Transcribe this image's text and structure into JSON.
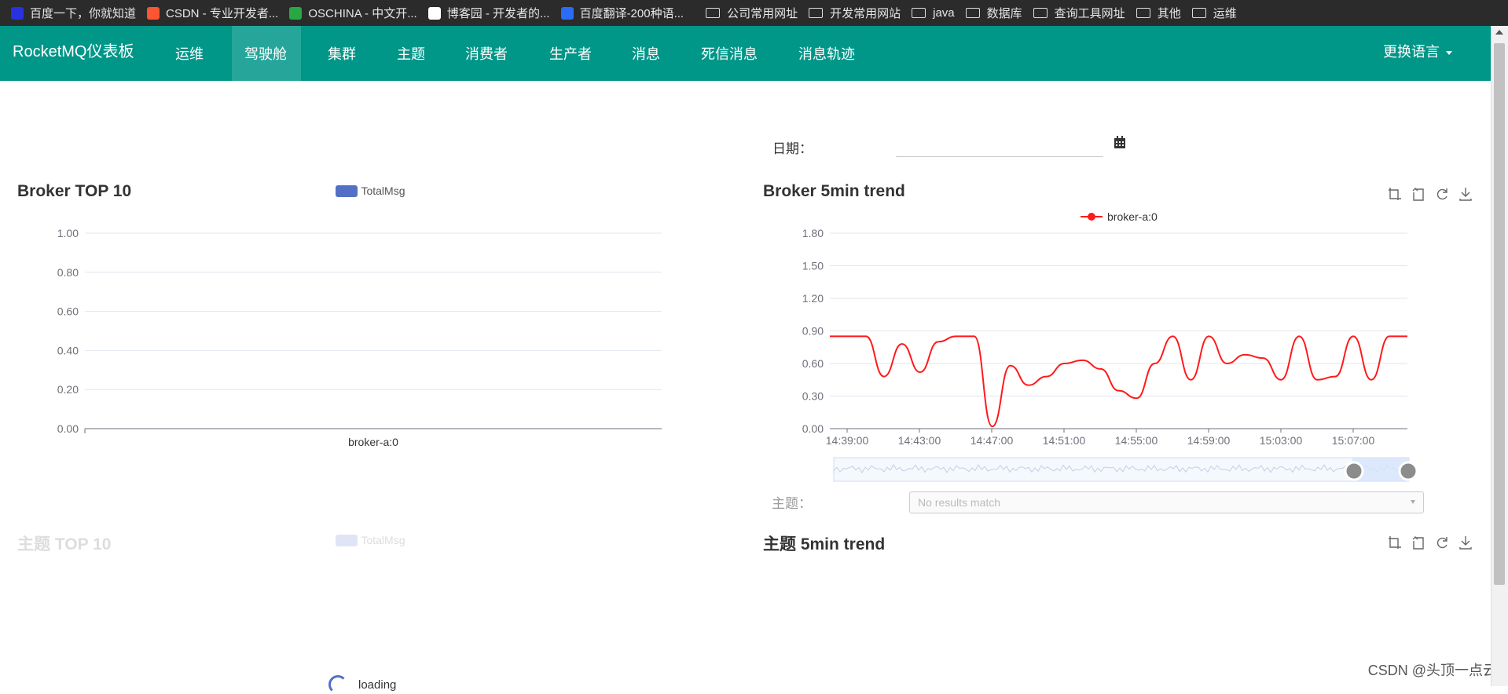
{
  "bookmarks": [
    {
      "label": "百度一下，你就知道",
      "icon": "baidu-icon",
      "color": "#2932e1"
    },
    {
      "label": "CSDN - 专业开发者...",
      "icon": "csdn-icon",
      "color": "#fc5531"
    },
    {
      "label": "OSCHINA - 中文开...",
      "icon": "oschina-icon",
      "color": "#28a745"
    },
    {
      "label": "博客园 - 开发者的...",
      "icon": "cnblogs-icon",
      "color": "#ffffff"
    },
    {
      "label": "百度翻译-200种语...",
      "icon": "translate-icon",
      "color": "#2b6cf6"
    },
    {
      "label": "公司常用网址",
      "icon": "folder-icon"
    },
    {
      "label": "开发常用网站",
      "icon": "folder-icon"
    },
    {
      "label": "java",
      "icon": "folder-icon"
    },
    {
      "label": "数据库",
      "icon": "folder-icon"
    },
    {
      "label": "查询工具网址",
      "icon": "folder-icon"
    },
    {
      "label": "其他",
      "icon": "folder-icon"
    },
    {
      "label": "运维",
      "icon": "folder-icon"
    }
  ],
  "nav": {
    "brand": "RocketMQ仪表板",
    "items": [
      "运维",
      "驾驶舱",
      "集群",
      "主题",
      "消费者",
      "生产者",
      "消息",
      "死信消息",
      "消息轨迹"
    ],
    "active": "驾驶舱",
    "language": "更换语言"
  },
  "date": {
    "label": "日期：",
    "value": ""
  },
  "topic_filter": {
    "label": "主题：",
    "placeholder": "No results match"
  },
  "panels": {
    "broker_top": "Broker TOP 10",
    "broker_trend": "Broker 5min trend",
    "topic_top": "主题 TOP 10",
    "topic_trend": "主题 5min trend"
  },
  "loading_text": "loading",
  "watermark": "CSDN @头顶一点云",
  "colors": {
    "nav": "#009688",
    "nav_active": "#26a69a",
    "bar": "#5470c6",
    "trend": "#ff1a1a"
  },
  "chart_data": [
    {
      "type": "bar",
      "legend": [
        "TotalMsg"
      ],
      "categories": [
        "broker-a:0"
      ],
      "values": [
        0
      ],
      "yticks": [
        "0.00",
        "0.20",
        "0.40",
        "0.60",
        "0.80",
        "1.00"
      ],
      "ylim": [
        0,
        1
      ],
      "grid": true
    },
    {
      "type": "line",
      "series": [
        {
          "name": "broker-a:0",
          "values": [
            0.85,
            0.85,
            0.85,
            0.48,
            0.78,
            0.52,
            0.8,
            0.85,
            0.85,
            0.02,
            0.58,
            0.4,
            0.48,
            0.6,
            0.63,
            0.55,
            0.35,
            0.28,
            0.6,
            0.85,
            0.45,
            0.85,
            0.6,
            0.68,
            0.65,
            0.45,
            0.85,
            0.45,
            0.48,
            0.85,
            0.45,
            0.85,
            0.85
          ]
        }
      ],
      "xticks": [
        "14:39:00",
        "14:43:00",
        "14:47:00",
        "14:51:00",
        "14:55:00",
        "14:59:00",
        "15:03:00",
        "15:07:00"
      ],
      "yticks": [
        "0.00",
        "0.30",
        "0.60",
        "0.90",
        "1.20",
        "1.50",
        "1.80"
      ],
      "ylim": [
        0,
        1.8
      ],
      "grid": true,
      "legend_position": "top-center",
      "datazoom": true
    }
  ]
}
